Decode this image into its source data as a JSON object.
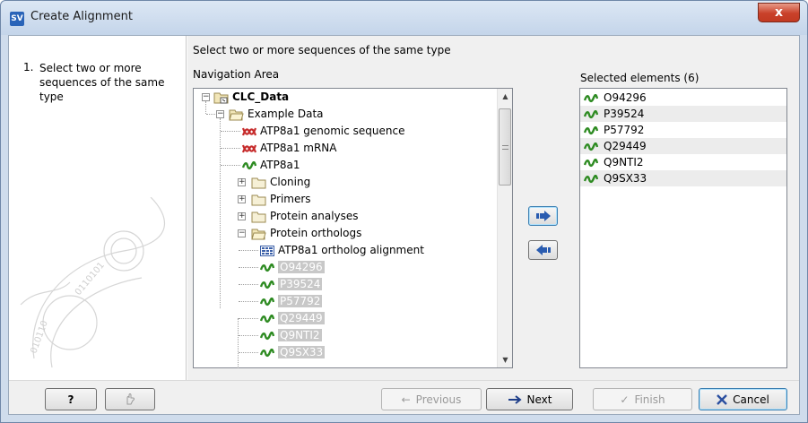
{
  "window": {
    "title": "Create Alignment",
    "app_badge": "SV",
    "close_glyph": "x"
  },
  "steps": [
    {
      "number": "1.",
      "text": "Select two or more sequences of the same type"
    }
  ],
  "header": {
    "instruction": "Select two or more sequences of the same type",
    "nav_label": "Navigation Area",
    "selected_label": "Selected elements (6)"
  },
  "tree": {
    "root": "CLC_Data",
    "example_data": "Example Data",
    "atp_genomic": "ATP8a1 genomic sequence",
    "atp_mrna": "ATP8a1 mRNA",
    "atp_protein": "ATP8a1",
    "cloning": "Cloning",
    "primers": "Primers",
    "protein_analyses": "Protein analyses",
    "protein_orthologs": "Protein orthologs",
    "ortholog_alignment": "ATP8a1 ortholog alignment",
    "orthologs": [
      "O94296",
      "P39524",
      "P57792",
      "Q29449",
      "Q9NTI2",
      "Q9SX33"
    ]
  },
  "selected_elements": [
    "O94296",
    "P39524",
    "P57792",
    "Q29449",
    "Q9NTI2",
    "Q9SX33"
  ],
  "icons": {
    "add": "arrow-right-icon",
    "remove": "arrow-left-icon",
    "dna": "dna-sequence-icon",
    "protein": "protein-sequence-icon",
    "folder": "folder-icon"
  },
  "colors": {
    "dna": "#c62b2b",
    "protein": "#2e8b22",
    "accent": "#3c7fb1"
  },
  "footer": {
    "help": "?",
    "previous": "Previous",
    "next": "Next",
    "finish": "Finish",
    "cancel": "Cancel"
  }
}
